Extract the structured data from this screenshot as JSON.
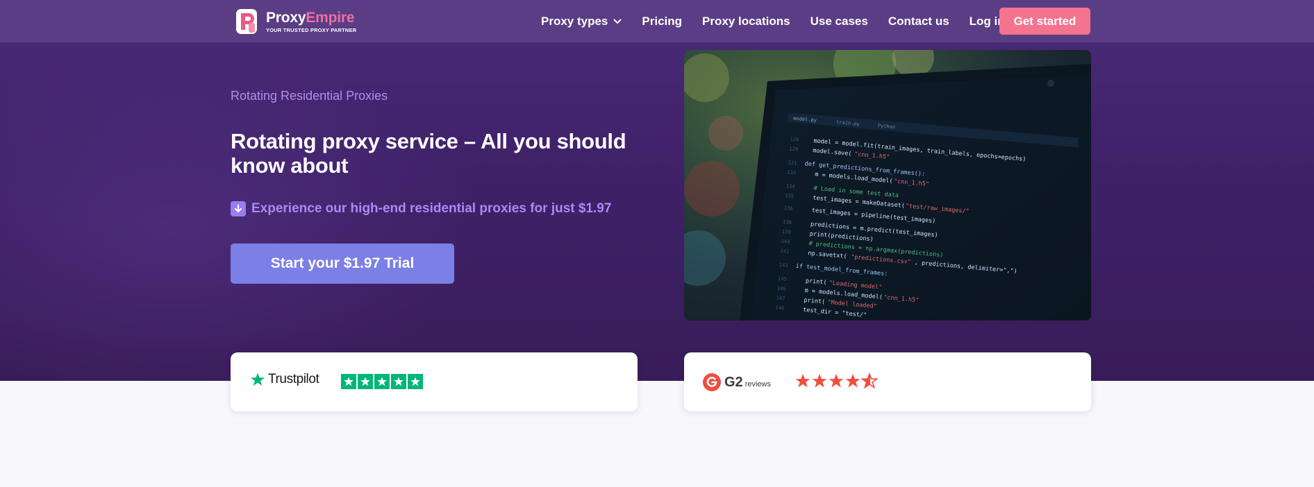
{
  "nav": {
    "logo_name_a": "Proxy",
    "logo_name_b": "Empire",
    "logo_tagline": "YOUR TRUSTED PROXY PARTNER",
    "links": [
      "Proxy types",
      "Pricing",
      "Proxy locations",
      "Use cases",
      "Contact us",
      "Log in"
    ],
    "cta": "Get started"
  },
  "hero": {
    "eyebrow": "Rotating Residential Proxies",
    "headline": "Rotating proxy service – All you should know about",
    "offer": "Experience our high-end residential proxies for just $1.97",
    "trial_button": "Start your $1.97 Trial"
  },
  "reviews": {
    "trustpilot": {
      "name": "Trustpilot",
      "stars": 5
    },
    "g2": {
      "name": "G2",
      "sub": "reviews",
      "stars": 4.5
    }
  },
  "colors": {
    "accent_pink": "#f4748f",
    "accent_purple": "#7b7fe6",
    "trustpilot_green": "#00b67a",
    "g2_red": "#ef4e3f"
  }
}
